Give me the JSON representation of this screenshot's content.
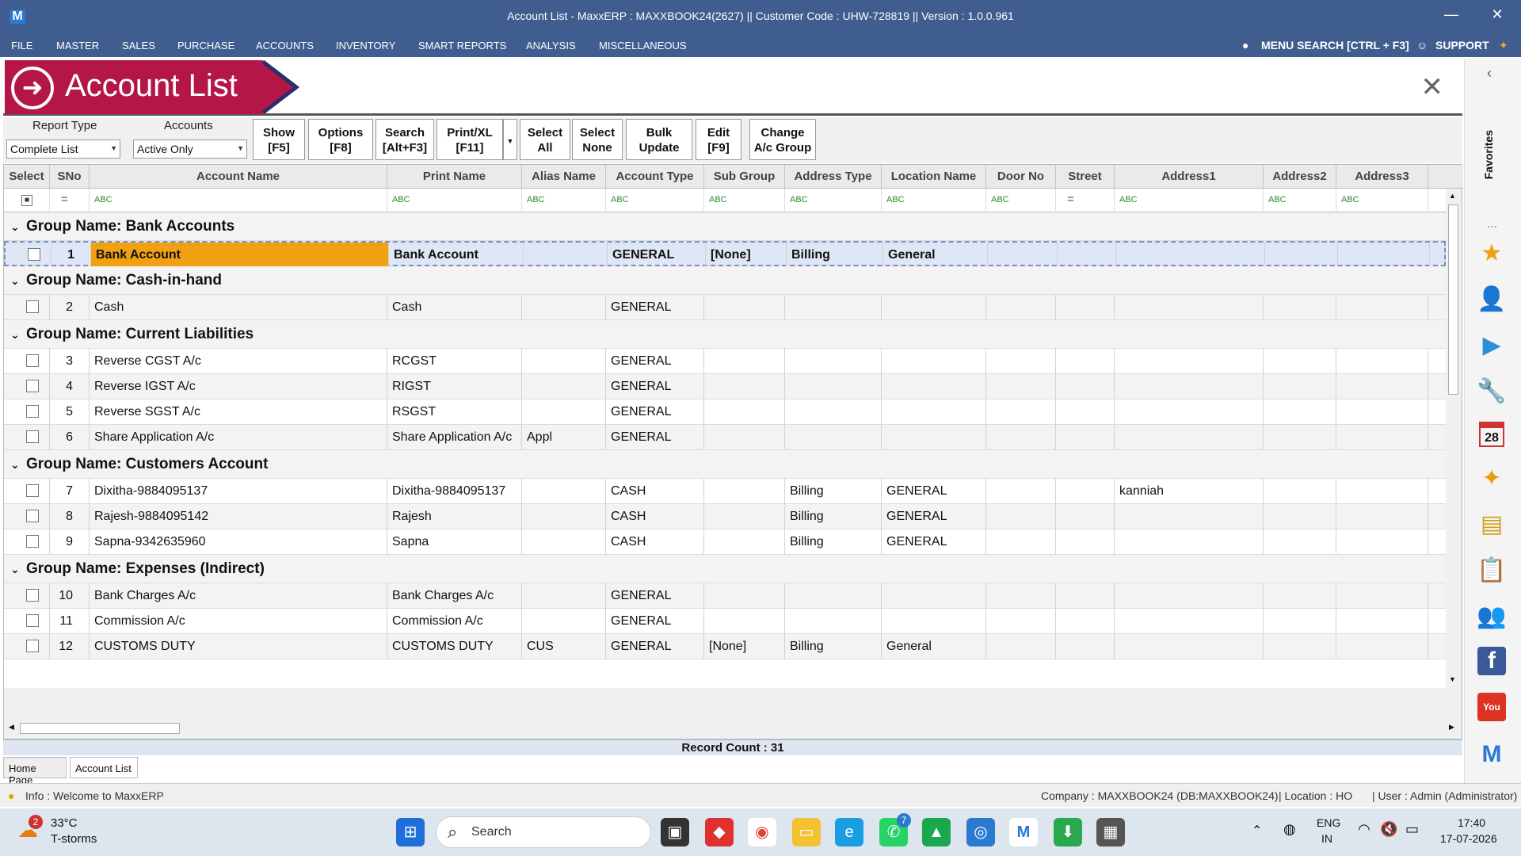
{
  "window": {
    "title": "Account List - MaxxERP : MAXXBOOK24(2627)  ||  Customer Code : UHW-728819  ||  Version : 1.0.0.961",
    "logo": "M",
    "minimize": "—",
    "close": "✕"
  },
  "menu": {
    "items": [
      "FILE",
      "MASTER",
      "SALES",
      "PURCHASE",
      "ACCOUNTS",
      "INVENTORY",
      "SMART REPORTS",
      "ANALYSIS",
      "MISCELLANEOUS"
    ],
    "menu_search": "MENU SEARCH [CTRL + F3]",
    "support": "SUPPORT"
  },
  "header": {
    "title": "Account List",
    "close": "✕"
  },
  "toolbar": {
    "report_type_label": "Report Type",
    "report_type_value": "Complete List",
    "accounts_label": "Accounts",
    "accounts_value": "Active Only",
    "buttons": [
      {
        "l1": "Show",
        "l2": "[F5]"
      },
      {
        "l1": "Options",
        "l2": "[F8]"
      },
      {
        "l1": "Search",
        "l2": "[Alt+F3]"
      },
      {
        "l1": "Print/XL",
        "l2": "[F11]"
      },
      {
        "l1": "Select",
        "l2": "All"
      },
      {
        "l1": "Select",
        "l2": "None"
      },
      {
        "l1": "Bulk",
        "l2": "Update"
      },
      {
        "l1": "Edit",
        "l2": "[F9]"
      },
      {
        "l1": "Change",
        "l2": "A/c Group"
      }
    ]
  },
  "grid": {
    "columns": [
      "Select",
      "SNo",
      "Account Name",
      "Print Name",
      "Alias Name",
      "Account Type",
      "Sub Group",
      "Address Type",
      "Location Name",
      "Door No",
      "Street",
      "Address1",
      "Address2",
      "Address3"
    ],
    "filter_glyph": "ABC",
    "filter_eq": "=",
    "groups": [
      {
        "name": "Group Name: Bank Accounts",
        "rows": [
          {
            "sno": "1",
            "account": "Bank Account",
            "print": "Bank Account",
            "alias": "",
            "type": "GENERAL",
            "sub": "[None]",
            "addrtype": "Billing",
            "location": "General",
            "address1": ""
          }
        ]
      },
      {
        "name": "Group Name: Cash-in-hand",
        "rows": [
          {
            "sno": "2",
            "account": "Cash",
            "print": "Cash",
            "alias": "",
            "type": "GENERAL",
            "sub": "",
            "addrtype": "",
            "location": "",
            "address1": ""
          }
        ]
      },
      {
        "name": "Group Name: Current Liabilities",
        "rows": [
          {
            "sno": "3",
            "account": "Reverse CGST A/c",
            "print": "RCGST",
            "alias": "",
            "type": "GENERAL",
            "sub": "",
            "addrtype": "",
            "location": "",
            "address1": ""
          },
          {
            "sno": "4",
            "account": "Reverse IGST A/c",
            "print": "RIGST",
            "alias": "",
            "type": "GENERAL",
            "sub": "",
            "addrtype": "",
            "location": "",
            "address1": ""
          },
          {
            "sno": "5",
            "account": "Reverse SGST A/c",
            "print": "RSGST",
            "alias": "",
            "type": "GENERAL",
            "sub": "",
            "addrtype": "",
            "location": "",
            "address1": ""
          },
          {
            "sno": "6",
            "account": "Share Application A/c",
            "print": "Share Application A/c",
            "alias": "Appl",
            "type": "GENERAL",
            "sub": "",
            "addrtype": "",
            "location": "",
            "address1": ""
          }
        ]
      },
      {
        "name": "Group Name: Customers Account",
        "rows": [
          {
            "sno": "7",
            "account": "Dixitha-9884095137",
            "print": "Dixitha-9884095137",
            "alias": "",
            "type": "CASH",
            "sub": "",
            "addrtype": "Billing",
            "location": "GENERAL",
            "address1": "kanniah"
          },
          {
            "sno": "8",
            "account": "Rajesh-9884095142",
            "print": "Rajesh",
            "alias": "",
            "type": "CASH",
            "sub": "",
            "addrtype": "Billing",
            "location": "GENERAL",
            "address1": ""
          },
          {
            "sno": "9",
            "account": "Sapna-9342635960",
            "print": "Sapna",
            "alias": "",
            "type": "CASH",
            "sub": "",
            "addrtype": "Billing",
            "location": "GENERAL",
            "address1": ""
          }
        ]
      },
      {
        "name": "Group Name: Expenses (Indirect)",
        "rows": [
          {
            "sno": "10",
            "account": "Bank Charges A/c",
            "print": "Bank Charges A/c",
            "alias": "",
            "type": "GENERAL",
            "sub": "",
            "addrtype": "",
            "location": "",
            "address1": ""
          },
          {
            "sno": "11",
            "account": "Commission A/c",
            "print": "Commission A/c",
            "alias": "",
            "type": "GENERAL",
            "sub": "",
            "addrtype": "",
            "location": "",
            "address1": ""
          },
          {
            "sno": "12",
            "account": "CUSTOMS DUTY",
            "print": "CUSTOMS DUTY",
            "alias": "CUS",
            "type": "GENERAL",
            "sub": "[None]",
            "addrtype": "Billing",
            "location": "General",
            "address1": ""
          }
        ]
      }
    ],
    "record_count": "Record Count : 31"
  },
  "tabs": [
    "Home Page",
    "Account List"
  ],
  "status": {
    "info": "Info : Welcome to MaxxERP",
    "company": "Company : MAXXBOOK24 (DB:MAXXBOOK24)",
    "location": "| Location : HO",
    "user": "| User : Admin (Administrator)"
  },
  "sidebar": {
    "favorites": "Favorites",
    "more": "...",
    "collapse": "‹",
    "icons": [
      "star-icon",
      "user-icon",
      "play-icon",
      "tools-icon",
      "calendar-icon",
      "broom-icon",
      "notes-icon",
      "clipboard-icon",
      "users-icon",
      "facebook-icon",
      "youtube-icon",
      "maxx-logo-icon"
    ],
    "calendar_day": "28"
  },
  "taskbar": {
    "weather_temp": "33°C",
    "weather_desc": "T-storms",
    "weather_badge": "2",
    "search_placeholder": "Search",
    "whatsapp_badge": "7",
    "lang1": "ENG",
    "lang2": "IN",
    "time": "17:40",
    "date": "17-07-2026"
  }
}
